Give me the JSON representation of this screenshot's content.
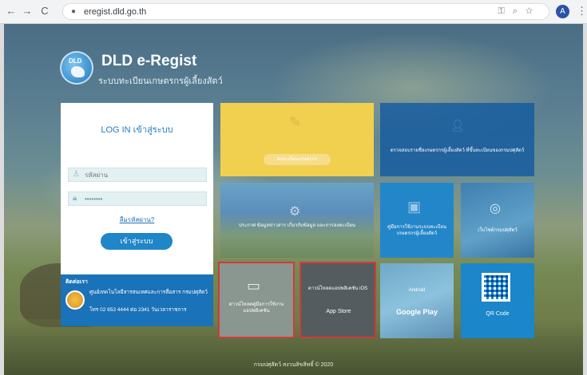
{
  "browser": {
    "url": "eregist.dld.go.th",
    "back": "←",
    "forward": "→",
    "reload": "C",
    "profile_initial": "A"
  },
  "brand": {
    "logo_text": "DLD",
    "title": "DLD e-Regist",
    "subtitle": "ระบบทะเบียนเกษตรกรผู้เลี้ยงสัตว์"
  },
  "login": {
    "title": "LOG IN เข้าสู่ระบบ",
    "username_placeholder": "รหัสผ่าน",
    "password_value": "••••••••",
    "forgot_label": "ลืมรหัสผ่าน?",
    "submit_label": "เข้าสู่ระบบ"
  },
  "contact": {
    "title": "ติดต่อเรา",
    "org": "ศูนย์เทคโนโลยีสารสนเทศและการสื่อสาร กรมปศุสัตว์",
    "phone": "โทร 02 653 4444 ต่อ 2341 วันเวลาราชการ"
  },
  "tiles": {
    "register_pill": "ลงทะเบียนเกษตรกร",
    "blue_label": "ตรวจสอบรายชื่อเกษตรกรผู้เลี้ยงสัตว์ ที่ขึ้นทะเบียนของกรมปศุสัตว์",
    "photo1_label": "ประกาศ ข้อมูลข่าวสาร เกี่ยวกับข้อมูล และการลงทะเบียน",
    "blue2_label": "คู่มือการใช้งานระบบทะเบียน เกษตรกรผู้เลี้ยงสัตว์",
    "photo2_label": "เว็บไซต์กรมปศุสัตว์",
    "manual_label": "ดาวน์โหลดคู่มือการใช้งาน แอปพลิเคชัน",
    "ios_label": "ดาวน์โหลดแอปพลิเคชัน iOS",
    "appstore_label": " App Store",
    "android_label": "Android",
    "gplay_label": "Google Play",
    "qr_label": "QR Code"
  },
  "footer": "กรมปศุสัตว์ สงวนลิขสิทธิ์ © 2020"
}
